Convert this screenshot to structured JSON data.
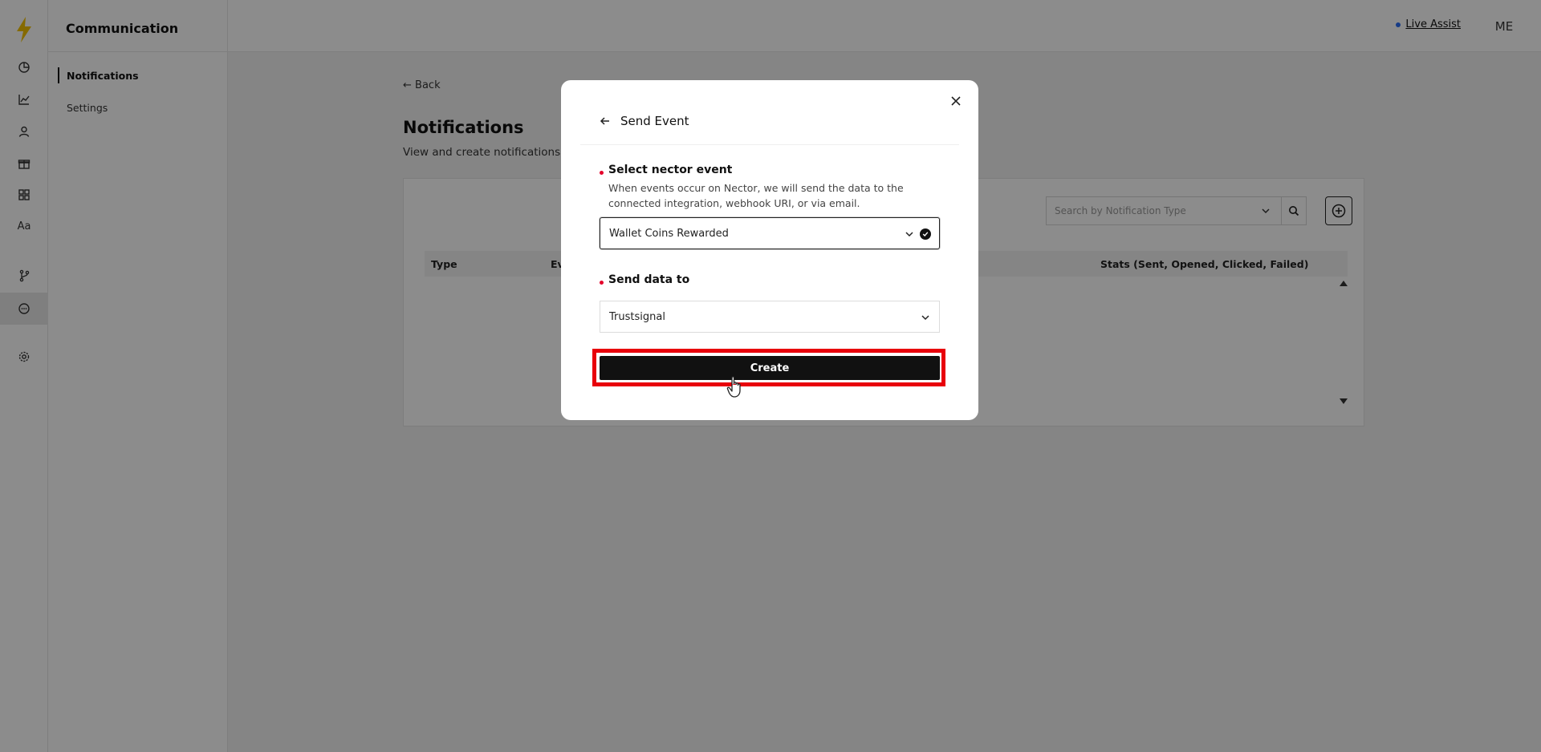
{
  "app": {
    "section_title": "Communication",
    "nav": [
      {
        "label": "Notifications",
        "active": true
      },
      {
        "label": "Settings",
        "active": false
      }
    ],
    "rail_icons": [
      "lightning-logo",
      "dashboard-icon",
      "analytics-icon",
      "user-icon",
      "gift-icon",
      "widgets-icon",
      "typography-icon",
      "branch-icon",
      "chat-icon",
      "settings-icon"
    ],
    "rail_text_icon": "Aa"
  },
  "header": {
    "live_assist": "Live Assist",
    "avatar_initials": "ME"
  },
  "page": {
    "back": "Back",
    "title": "Notifications",
    "subtitle": "View and create notifications t",
    "search_placeholder": "Search by Notification Type",
    "table_headers": [
      "Type",
      "Ev",
      "Stats (Sent, Opened, Clicked, Failed)"
    ]
  },
  "modal": {
    "title": "Send Event",
    "field1_label": "Select nector event",
    "field1_description": "When events occur on Nector, we will send the data to the connected integration, webhook URI, or via email.",
    "field1_value": "Wallet Coins Rewarded",
    "field2_label": "Send data to",
    "field2_value": "Trustsignal",
    "create_label": "Create"
  },
  "colors": {
    "accent": "#111111",
    "required": "#e4002b",
    "highlight": "#e8000b",
    "live_dot": "#2a6ef5",
    "logo": "#f2c200"
  }
}
